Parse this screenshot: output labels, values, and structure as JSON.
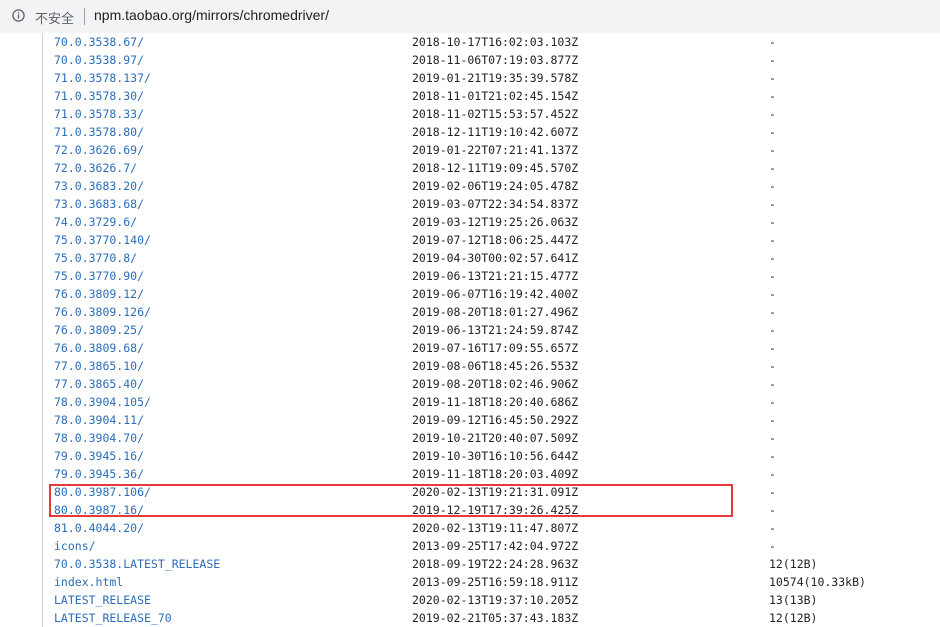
{
  "browser": {
    "security_label": "不安全",
    "url": "npm.taobao.org/mirrors/chromedriver/"
  },
  "entries": [
    {
      "name": "70.0.3538.67/",
      "date": "2018-10-17T16:02:03.103Z",
      "size": "-"
    },
    {
      "name": "70.0.3538.97/",
      "date": "2018-11-06T07:19:03.877Z",
      "size": "-"
    },
    {
      "name": "71.0.3578.137/",
      "date": "2019-01-21T19:35:39.578Z",
      "size": "-"
    },
    {
      "name": "71.0.3578.30/",
      "date": "2018-11-01T21:02:45.154Z",
      "size": "-"
    },
    {
      "name": "71.0.3578.33/",
      "date": "2018-11-02T15:53:57.452Z",
      "size": "-"
    },
    {
      "name": "71.0.3578.80/",
      "date": "2018-12-11T19:10:42.607Z",
      "size": "-"
    },
    {
      "name": "72.0.3626.69/",
      "date": "2019-01-22T07:21:41.137Z",
      "size": "-"
    },
    {
      "name": "72.0.3626.7/",
      "date": "2018-12-11T19:09:45.570Z",
      "size": "-"
    },
    {
      "name": "73.0.3683.20/",
      "date": "2019-02-06T19:24:05.478Z",
      "size": "-"
    },
    {
      "name": "73.0.3683.68/",
      "date": "2019-03-07T22:34:54.837Z",
      "size": "-"
    },
    {
      "name": "74.0.3729.6/",
      "date": "2019-03-12T19:25:26.063Z",
      "size": "-"
    },
    {
      "name": "75.0.3770.140/",
      "date": "2019-07-12T18:06:25.447Z",
      "size": "-"
    },
    {
      "name": "75.0.3770.8/",
      "date": "2019-04-30T00:02:57.641Z",
      "size": "-"
    },
    {
      "name": "75.0.3770.90/",
      "date": "2019-06-13T21:21:15.477Z",
      "size": "-"
    },
    {
      "name": "76.0.3809.12/",
      "date": "2019-06-07T16:19:42.400Z",
      "size": "-"
    },
    {
      "name": "76.0.3809.126/",
      "date": "2019-08-20T18:01:27.496Z",
      "size": "-"
    },
    {
      "name": "76.0.3809.25/",
      "date": "2019-06-13T21:24:59.874Z",
      "size": "-"
    },
    {
      "name": "76.0.3809.68/",
      "date": "2019-07-16T17:09:55.657Z",
      "size": "-"
    },
    {
      "name": "77.0.3865.10/",
      "date": "2019-08-06T18:45:26.553Z",
      "size": "-"
    },
    {
      "name": "77.0.3865.40/",
      "date": "2019-08-20T18:02:46.906Z",
      "size": "-"
    },
    {
      "name": "78.0.3904.105/",
      "date": "2019-11-18T18:20:40.686Z",
      "size": "-"
    },
    {
      "name": "78.0.3904.11/",
      "date": "2019-09-12T16:45:50.292Z",
      "size": "-"
    },
    {
      "name": "78.0.3904.70/",
      "date": "2019-10-21T20:40:07.509Z",
      "size": "-"
    },
    {
      "name": "79.0.3945.16/",
      "date": "2019-10-30T16:10:56.644Z",
      "size": "-"
    },
    {
      "name": "79.0.3945.36/",
      "date": "2019-11-18T18:20:03.409Z",
      "size": "-"
    },
    {
      "name": "80.0.3987.106/",
      "date": "2020-02-13T19:21:31.091Z",
      "size": "-"
    },
    {
      "name": "80.0.3987.16/",
      "date": "2019-12-19T17:39:26.425Z",
      "size": "-"
    },
    {
      "name": "81.0.4044.20/",
      "date": "2020-02-13T19:11:47.807Z",
      "size": "-"
    },
    {
      "name": "icons/",
      "date": "2013-09-25T17:42:04.972Z",
      "size": "-"
    },
    {
      "name": "70.0.3538.LATEST_RELEASE",
      "date": "2018-09-19T22:24:28.963Z",
      "size": "12(12B)"
    },
    {
      "name": "index.html",
      "date": "2013-09-25T16:59:18.911Z",
      "size": "10574(10.33kB)"
    },
    {
      "name": "LATEST_RELEASE",
      "date": "2020-02-13T19:37:10.205Z",
      "size": "13(13B)"
    },
    {
      "name": "LATEST_RELEASE_70",
      "date": "2019-02-21T05:37:43.183Z",
      "size": "12(12B)"
    }
  ],
  "colors": {
    "link": "#2a6db8",
    "highlight_box": "#e8393a"
  }
}
